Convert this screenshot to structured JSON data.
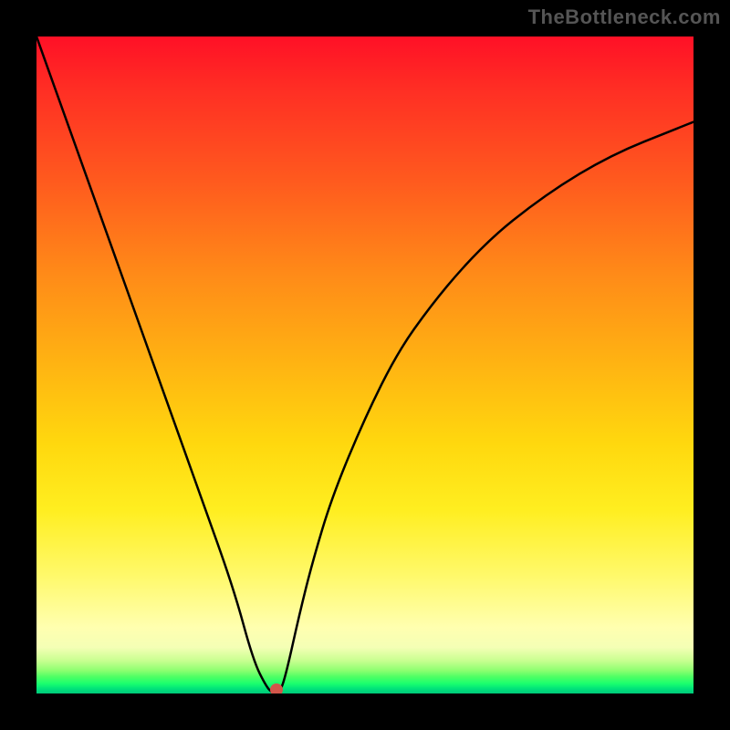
{
  "watermark": "TheBottleneck.com",
  "chart_data": {
    "type": "line",
    "title": "",
    "xlabel": "",
    "ylabel": "",
    "xlim": [
      0,
      100
    ],
    "ylim": [
      0,
      100
    ],
    "grid": false,
    "series": [
      {
        "name": "bottleneck-curve",
        "x": [
          0,
          5,
          10,
          15,
          20,
          25,
          30,
          33,
          35,
          36,
          37,
          38,
          40,
          42,
          45,
          50,
          55,
          60,
          65,
          70,
          75,
          80,
          85,
          90,
          95,
          100
        ],
        "values": [
          100,
          86,
          72,
          58,
          44,
          30,
          16,
          5,
          1,
          0,
          0,
          3,
          12,
          20,
          30,
          42,
          52,
          59,
          65,
          70,
          74,
          77.5,
          80.5,
          83,
          85,
          87
        ]
      }
    ],
    "marker": {
      "x": 36.5,
      "y": 0.5,
      "color": "#d2564a"
    },
    "background_gradient": {
      "stops": [
        {
          "pct": 0,
          "color": "#ff1026"
        },
        {
          "pct": 50,
          "color": "#ffb412"
        },
        {
          "pct": 82,
          "color": "#fff96a"
        },
        {
          "pct": 97,
          "color": "#4cff64"
        },
        {
          "pct": 100,
          "color": "#00c87a"
        }
      ]
    }
  }
}
